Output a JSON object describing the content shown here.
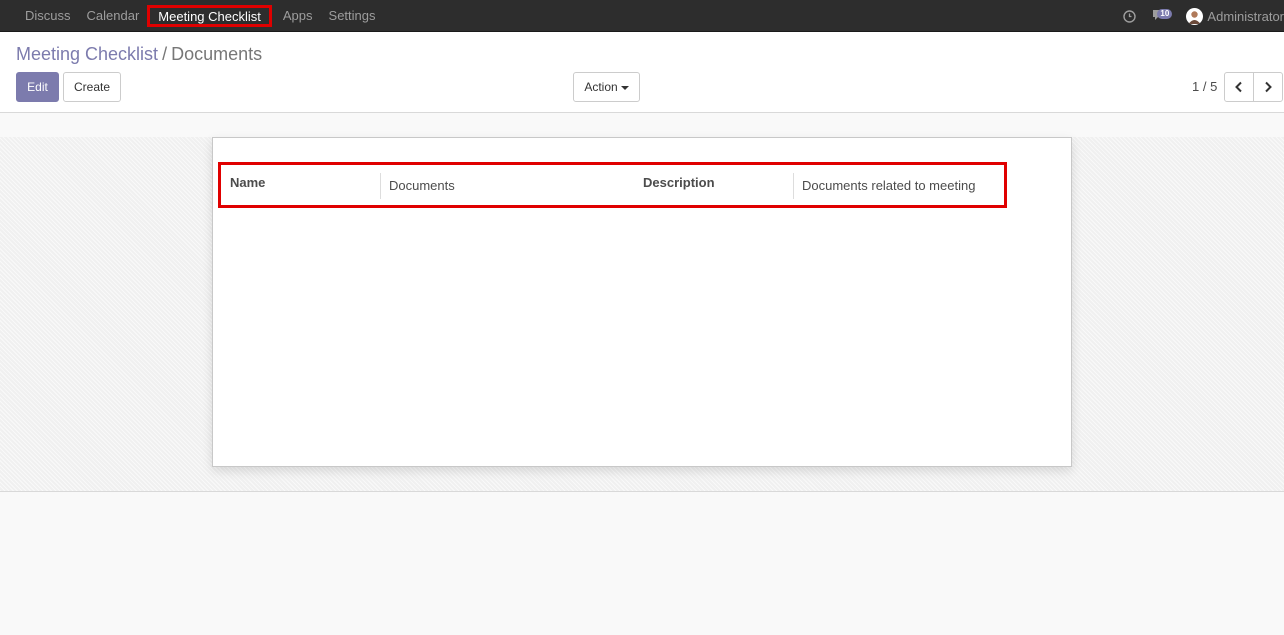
{
  "nav": {
    "items": [
      "Discuss",
      "Calendar",
      "Meeting Checklist",
      "Apps",
      "Settings"
    ],
    "active_index": 2,
    "message_count": "10",
    "user_name": "Administrator"
  },
  "breadcrumb": {
    "parent": "Meeting Checklist",
    "separator": "/",
    "current": "Documents"
  },
  "buttons": {
    "edit": "Edit",
    "create": "Create",
    "action": "Action"
  },
  "pager": {
    "text": "1 / 5"
  },
  "form": {
    "name_label": "Name",
    "name_value": "Documents",
    "description_label": "Description",
    "description_value": "Documents related to meeting"
  },
  "colors": {
    "brand": "#7c7bad",
    "highlight": "#e00000",
    "navbar": "#2d2d2d"
  }
}
